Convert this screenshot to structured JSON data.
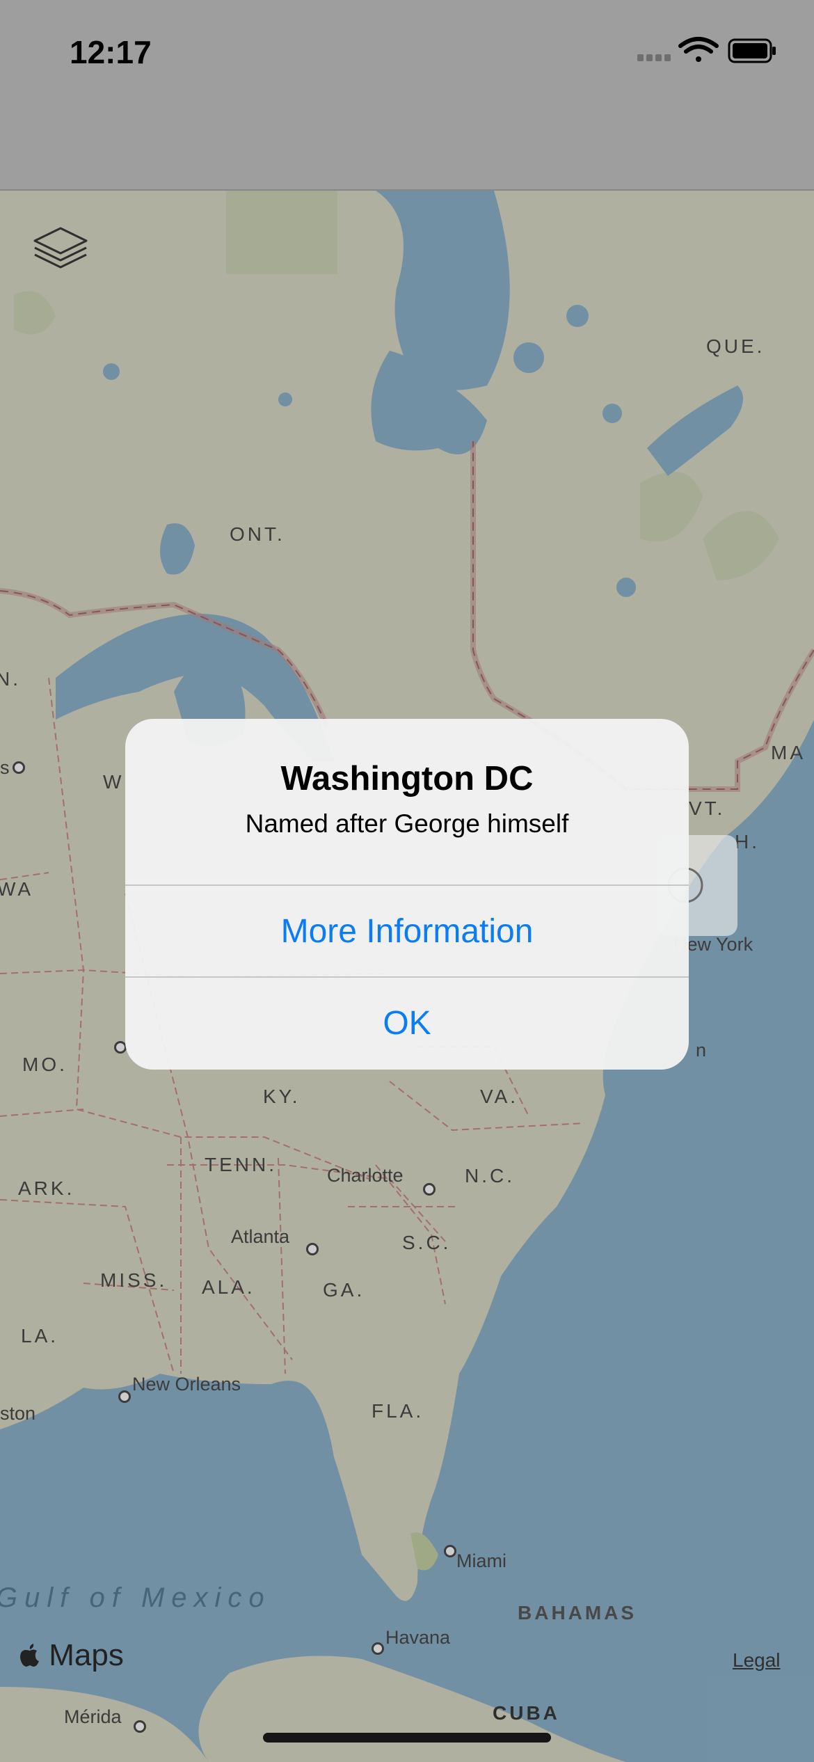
{
  "status_bar": {
    "time": "12:17",
    "signal_icon": "signal-icon",
    "wifi_icon": "wifi-icon",
    "battery_icon": "battery-icon"
  },
  "map": {
    "region_labels": [
      "QUE.",
      "ONT.",
      "N.",
      "W",
      "WA",
      "MO.",
      "KY.",
      "VA.",
      "TENN.",
      "N.C.",
      "ARK.",
      "S.C.",
      "MISS.",
      "ALA.",
      "GA.",
      "LA.",
      "FLA.",
      "BAHAMAS",
      "CUBA",
      "VT.",
      "H.",
      "MA",
      "s"
    ],
    "cities": [
      "New York",
      "Charlotte",
      "Atlanta",
      "New Orleans",
      "Miami",
      "Havana",
      "Mérida",
      "ston",
      "n"
    ],
    "sea": "Gulf of Mexico",
    "layers_icon": "layers-icon",
    "logo_text": "Maps",
    "logo_icon": "apple-logo-icon",
    "legal": "Legal"
  },
  "alert": {
    "title": "Washington DC",
    "message": "Named after George himself",
    "buttons": [
      "More Information",
      "OK"
    ]
  },
  "colors": {
    "land": "#dcdcc8",
    "water": "#8fb5cd",
    "accent": "#0a7cf6",
    "border": "#d38f8f"
  }
}
